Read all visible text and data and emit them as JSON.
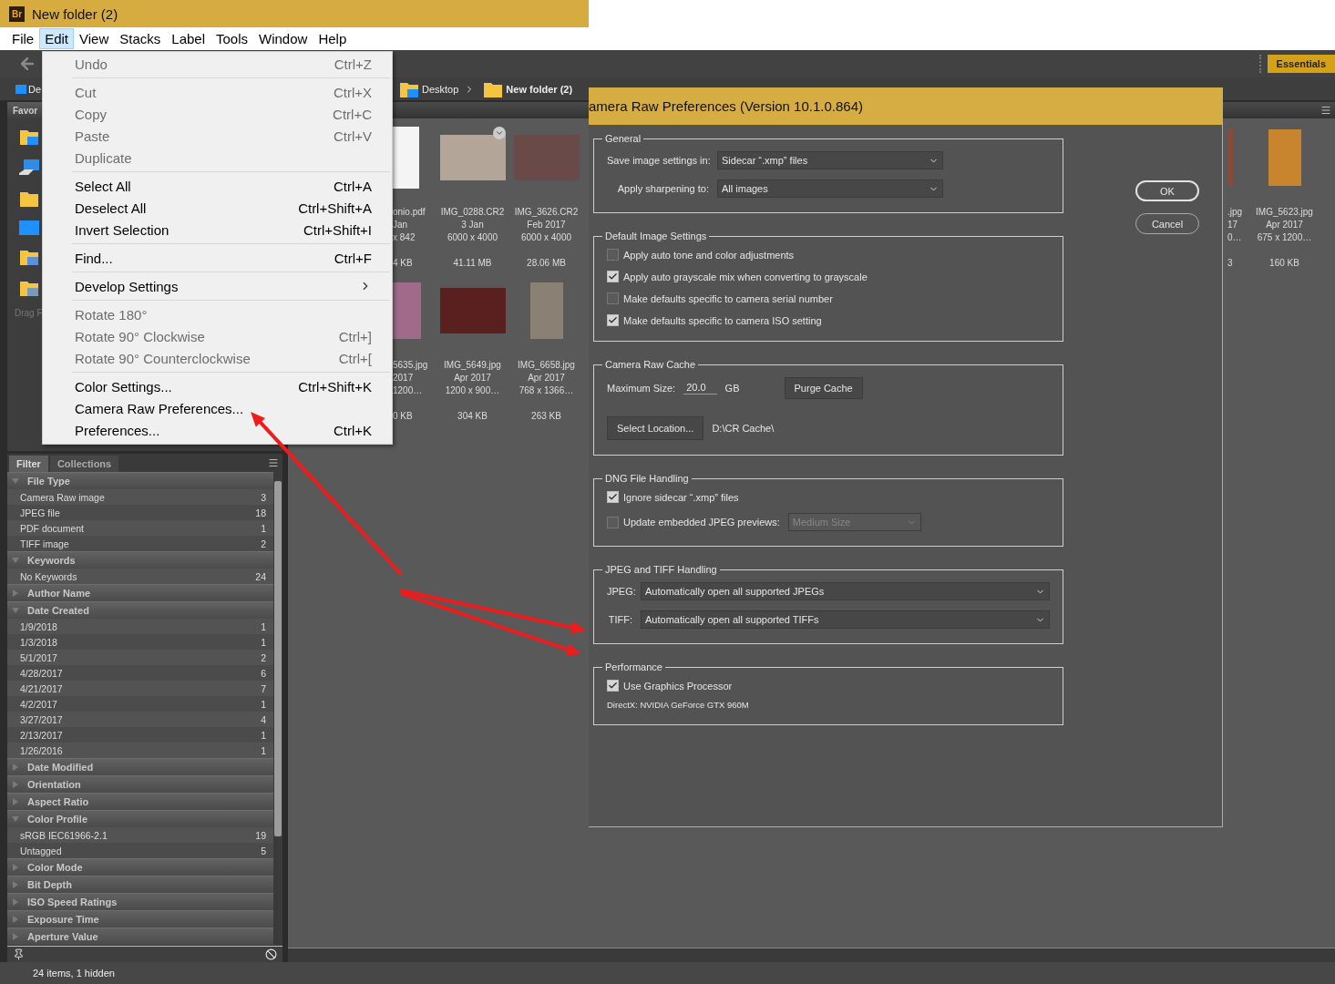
{
  "app": {
    "logo": "Br",
    "title": "New folder (2)"
  },
  "menubar": [
    {
      "label": "File",
      "selected": false
    },
    {
      "label": "Edit",
      "selected": true
    },
    {
      "label": "View",
      "selected": false
    },
    {
      "label": "Stacks",
      "selected": false
    },
    {
      "label": "Label",
      "selected": false
    },
    {
      "label": "Tools",
      "selected": false
    },
    {
      "label": "Window",
      "selected": false
    },
    {
      "label": "Help",
      "selected": false
    }
  ],
  "toolbar": {
    "workspace": "Essentials"
  },
  "path_bar": {
    "left_crumb": "De",
    "crumbs": [
      "Desktop",
      "New folder (2)"
    ]
  },
  "favorites": {
    "title": "Favor",
    "hint": "Drag F"
  },
  "thumbnail_grid": {
    "rows": [
      {
        "left": [
          {
            "kind": "document",
            "cut": true,
            "name": "onio.pdf",
            "date": "Jan",
            "dimensions": "x 842",
            "file_size": "4 KB"
          },
          {
            "kind": "landscape",
            "cut": false,
            "name": "IMG_0288.CR2",
            "date": "3 Jan",
            "dimensions": "6000 x 4000",
            "file_size": "41.11 MB"
          },
          {
            "kind": "landscape",
            "cut": false,
            "name": "IMG_3626.CR2",
            "date": "Feb 2017",
            "dimensions": "6000 x 4000",
            "file_size": "28.06 MB"
          }
        ],
        "right": [
          {
            "kind": "portrait",
            "cut": true,
            "name": ".jpg",
            "date": "17",
            "dimensions": "0…",
            "file_size": "3"
          },
          {
            "kind": "portrait",
            "cut": false,
            "name": "IMG_5623.jpg",
            "date": "Apr 2017",
            "dimensions": "675 x 1200…",
            "file_size": "160 KB"
          }
        ]
      },
      {
        "left": [
          {
            "kind": "portrait",
            "cut": true,
            "name": "5635.jpg",
            "date": "2017",
            "dimensions": "1200…",
            "file_size": "0 KB"
          },
          {
            "kind": "landscape",
            "cut": false,
            "name": "IMG_5649.jpg",
            "date": "Apr 2017",
            "dimensions": "1200 x 900…",
            "file_size": "304 KB"
          },
          {
            "kind": "portrait",
            "cut": false,
            "name": "IMG_6658.jpg",
            "date": "Apr 2017",
            "dimensions": "768 x 1366…",
            "file_size": "263 KB"
          }
        ]
      }
    ]
  },
  "filter_panel": {
    "tabs": [
      {
        "label": "Filter",
        "selected": true
      },
      {
        "label": "Collections",
        "selected": false
      }
    ],
    "sections": [
      {
        "title": "File Type",
        "expanded": true,
        "items": [
          {
            "label": "Camera Raw image",
            "count": "3"
          },
          {
            "label": "JPEG file",
            "count": "18"
          },
          {
            "label": "PDF document",
            "count": "1"
          },
          {
            "label": "TIFF image",
            "count": "2"
          }
        ]
      },
      {
        "title": "Keywords",
        "expanded": true,
        "items": [
          {
            "label": "No Keywords",
            "count": "24"
          }
        ]
      },
      {
        "title": "Author Name",
        "expanded": false
      },
      {
        "title": "Date Created",
        "expanded": true,
        "items": [
          {
            "label": "1/9/2018",
            "count": "1"
          },
          {
            "label": "1/3/2018",
            "count": "1"
          },
          {
            "label": "5/1/2017",
            "count": "2"
          },
          {
            "label": "4/28/2017",
            "count": "6"
          },
          {
            "label": "4/21/2017",
            "count": "7"
          },
          {
            "label": "4/2/2017",
            "count": "1"
          },
          {
            "label": "3/27/2017",
            "count": "4"
          },
          {
            "label": "2/13/2017",
            "count": "1"
          },
          {
            "label": "1/26/2016",
            "count": "1"
          }
        ]
      },
      {
        "title": "Date Modified",
        "expanded": false
      },
      {
        "title": "Orientation",
        "expanded": false
      },
      {
        "title": "Aspect Ratio",
        "expanded": false
      },
      {
        "title": "Color Profile",
        "expanded": true,
        "items": [
          {
            "label": "sRGB IEC61966-2.1",
            "count": "19"
          },
          {
            "label": "Untagged",
            "count": "5"
          }
        ]
      },
      {
        "title": "Color Mode",
        "expanded": false
      },
      {
        "title": "Bit Depth",
        "expanded": false
      },
      {
        "title": "ISO Speed Ratings",
        "expanded": false
      },
      {
        "title": "Exposure Time",
        "expanded": false
      },
      {
        "title": "Aperture Value",
        "expanded": false
      }
    ]
  },
  "status_bar": "24 items, 1 hidden",
  "edit_menu": {
    "groups": [
      [
        {
          "label": "Undo",
          "shortcut": "Ctrl+Z",
          "disabled": true
        }
      ],
      [
        {
          "label": "Cut",
          "shortcut": "Ctrl+X",
          "disabled": true
        },
        {
          "label": "Copy",
          "shortcut": "Ctrl+C",
          "disabled": true
        },
        {
          "label": "Paste",
          "shortcut": "Ctrl+V",
          "disabled": true
        },
        {
          "label": "Duplicate",
          "disabled": true
        }
      ],
      [
        {
          "label": "Select All",
          "shortcut": "Ctrl+A",
          "disabled": false
        },
        {
          "label": "Deselect All",
          "shortcut": "Ctrl+Shift+A",
          "disabled": false
        },
        {
          "label": "Invert Selection",
          "shortcut": "Ctrl+Shift+I",
          "disabled": false
        }
      ],
      [
        {
          "label": "Find...",
          "shortcut": "Ctrl+F",
          "disabled": false
        }
      ],
      [
        {
          "label": "Develop Settings",
          "submenu": true,
          "disabled": false
        }
      ],
      [
        {
          "label": "Rotate 180°",
          "disabled": true
        },
        {
          "label": "Rotate 90° Clockwise",
          "shortcut": "Ctrl+]",
          "disabled": true
        },
        {
          "label": "Rotate 90° Counterclockwise",
          "shortcut": "Ctrl+[",
          "disabled": true
        }
      ],
      [
        {
          "label": "Color Settings...",
          "shortcut": "Ctrl+Shift+K",
          "disabled": false
        },
        {
          "label": "Camera Raw Preferences...",
          "disabled": false
        },
        {
          "label": "Preferences...",
          "shortcut": "Ctrl+K",
          "disabled": false
        }
      ]
    ]
  },
  "dialog": {
    "title": "amera Raw Preferences  (Version 10.1.0.864)",
    "buttons": [
      {
        "label": "OK",
        "default": true
      },
      {
        "label": "Cancel",
        "default": false
      }
    ],
    "sections": [
      {
        "title": "General",
        "rows": [
          {
            "kind": "dropdown",
            "label": "Save image settings in:",
            "value": "Sidecar “.xmp” files"
          },
          {
            "kind": "dropdown",
            "label": "Apply sharpening to:",
            "value": "All images"
          }
        ]
      },
      {
        "title": "Default Image Settings",
        "rows": [
          {
            "kind": "checkbox",
            "label": "Apply auto tone and color adjustments",
            "checked": false
          },
          {
            "kind": "checkbox",
            "label": "Apply auto grayscale mix when converting to grayscale",
            "checked": true
          },
          {
            "kind": "checkbox",
            "label": "Make defaults specific to camera serial number",
            "checked": false
          },
          {
            "kind": "checkbox",
            "label": "Make defaults specific to camera ISO setting",
            "checked": true
          }
        ]
      },
      {
        "title": "Camera Raw Cache",
        "rows": [
          {
            "kind": "size",
            "label": "Maximum Size:",
            "value": "20.0",
            "unit": "GB",
            "button": "Purge Cache"
          },
          {
            "kind": "location",
            "button": "Select Location...",
            "path": "D:\\CR Cache\\"
          }
        ]
      },
      {
        "title": "DNG File Handling",
        "rows": [
          {
            "kind": "checkbox",
            "label": "Ignore sidecar “.xmp” files",
            "checked": true
          },
          {
            "kind": "checkbox_dropdown",
            "label": "Update embedded JPEG previews:",
            "checked": false,
            "value": "Medium Size",
            "disabled": true
          }
        ]
      },
      {
        "title": "JPEG and TIFF Handling",
        "rows": [
          {
            "kind": "wide_dropdown",
            "label": "JPEG:",
            "value": "Automatically open all supported JPEGs"
          },
          {
            "kind": "wide_dropdown",
            "label": "TIFF:",
            "value": "Automatically open all supported TIFFs"
          }
        ]
      },
      {
        "title": "Performance",
        "rows": [
          {
            "kind": "checkbox",
            "label": "Use Graphics Processor",
            "checked": true
          },
          {
            "kind": "note",
            "text": "DirectX: NVIDIA GeForce GTX 960M"
          }
        ]
      }
    ]
  }
}
